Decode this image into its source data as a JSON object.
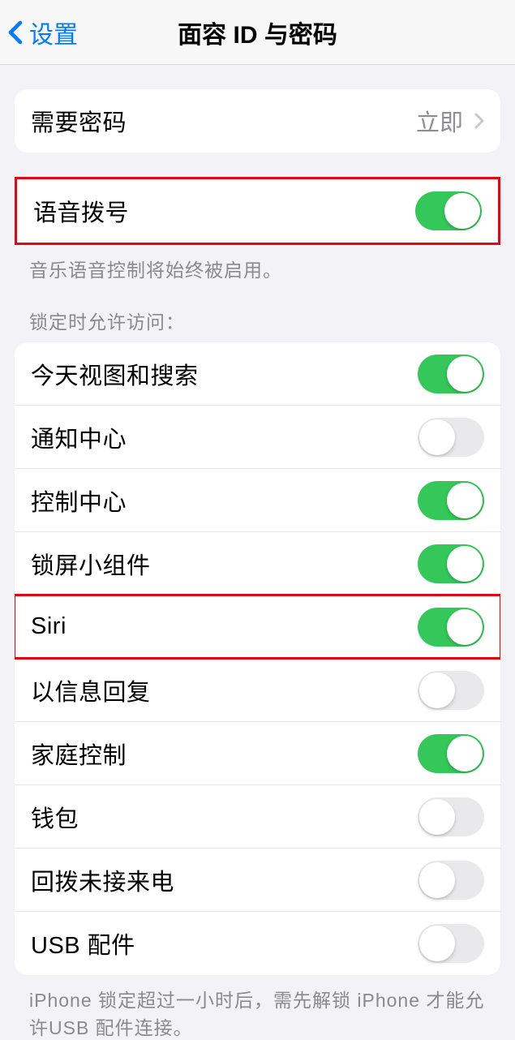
{
  "nav": {
    "back_label": "设置",
    "title": "面容 ID 与密码"
  },
  "passcode_group": {
    "require_passcode_label": "需要密码",
    "require_passcode_value": "立即"
  },
  "voice_dial": {
    "label": "语音拨号",
    "on": true,
    "footer": "音乐语音控制将始终被启用。"
  },
  "lock_access": {
    "header": "锁定时允许访问：",
    "items": [
      {
        "label": "今天视图和搜索",
        "on": true,
        "highlighted": false
      },
      {
        "label": "通知中心",
        "on": false,
        "highlighted": false
      },
      {
        "label": "控制中心",
        "on": true,
        "highlighted": false
      },
      {
        "label": "锁屏小组件",
        "on": true,
        "highlighted": false
      },
      {
        "label": "Siri",
        "on": true,
        "highlighted": true
      },
      {
        "label": "以信息回复",
        "on": false,
        "highlighted": false
      },
      {
        "label": "家庭控制",
        "on": true,
        "highlighted": false
      },
      {
        "label": "钱包",
        "on": false,
        "highlighted": false
      },
      {
        "label": "回拨未接来电",
        "on": false,
        "highlighted": false
      },
      {
        "label": "USB 配件",
        "on": false,
        "highlighted": false
      }
    ],
    "footer": "iPhone 锁定超过一小时后，需先解锁 iPhone 才能允许USB 配件连接。"
  }
}
